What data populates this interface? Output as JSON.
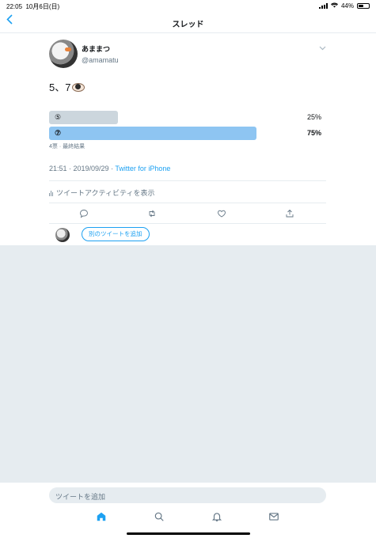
{
  "status_bar": {
    "time": "22:05",
    "date": "10月6日(日)",
    "battery_percent": "44%",
    "battery_level": 0.44
  },
  "nav": {
    "back_icon": "chevron-left-icon",
    "title": "スレッド"
  },
  "tweet": {
    "author_name": "あままつ",
    "author_handle": "@amamatu",
    "text": "5、7",
    "emoji": "eye-icon",
    "poll": {
      "options": [
        {
          "label": "⑤",
          "percent": "25%",
          "value": 0.25,
          "color": "#ccd6dd"
        },
        {
          "label": "⑦",
          "percent": "75%",
          "value": 0.75,
          "color": "#8ec5f2"
        }
      ],
      "meta": "4票 · 最終結果"
    },
    "time": "21:51 · 2019/09/29 · ",
    "source": "Twitter for iPhone",
    "activity_label": "ツイートアクティビティを表示"
  },
  "reply_row": {
    "add_button": "別のツイートを追加"
  },
  "compose": {
    "placeholder": "ツイートを追加"
  },
  "tabs": [
    "home-icon",
    "search-icon",
    "notifications-icon",
    "messages-icon"
  ],
  "colors": {
    "accent": "#1da1f2",
    "muted": "#657786",
    "background_gray": "#e6ecf0"
  }
}
